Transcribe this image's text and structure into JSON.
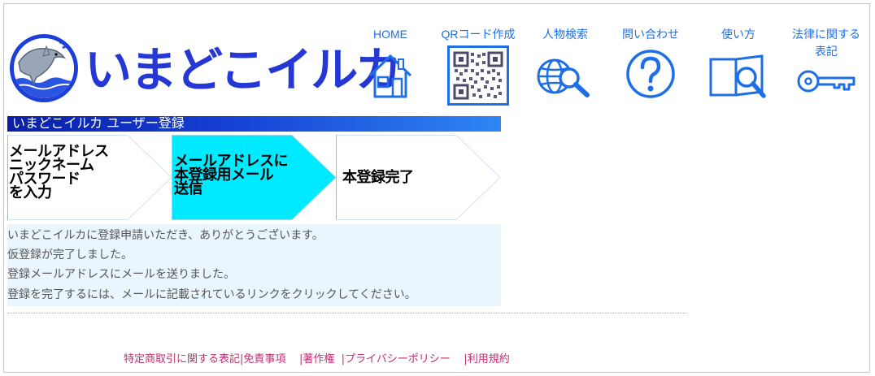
{
  "brand": {
    "logo_text": "いまどこイルカ"
  },
  "nav": [
    {
      "label": "HOME",
      "icon": "home-icon"
    },
    {
      "label": "QRコード作成",
      "icon": "qr-code-icon"
    },
    {
      "label": "人物検索",
      "icon": "globe-search-icon"
    },
    {
      "label": "問い合わせ",
      "icon": "question-icon"
    },
    {
      "label": "使い方",
      "icon": "book-search-icon"
    },
    {
      "label": "法律に関する",
      "label2": "表記",
      "icon": "key-icon"
    }
  ],
  "section_title": "いまどこイルカ ユーザー登録",
  "steps": [
    {
      "text": "メールアドレス\nニックネーム\nパスワード\nを入力",
      "active": false
    },
    {
      "text": "メールアドレスに\n本登録用メール\n送信",
      "active": true
    },
    {
      "text": "本登録完了",
      "active": false
    }
  ],
  "messages": [
    "いまどこイルカに登録申請いただき、ありがとうございます。",
    "仮登録が完了しました。",
    "登録メールアドレスにメールを送りました。",
    "登録を完了するには、メールに記載されているリンクをクリックしてください。"
  ],
  "footer": {
    "links": [
      "特定商取引に関する表記",
      "免責事項",
      "著作権",
      "プライバシーポリシー",
      "利用規約"
    ],
    "separator": "|"
  },
  "colors": {
    "nav_text": "#1e6fe6",
    "logo": "#2538d6",
    "active_step": "#00eaff",
    "footer_link": "#c0306e",
    "message_bg": "#e9f6fd"
  }
}
